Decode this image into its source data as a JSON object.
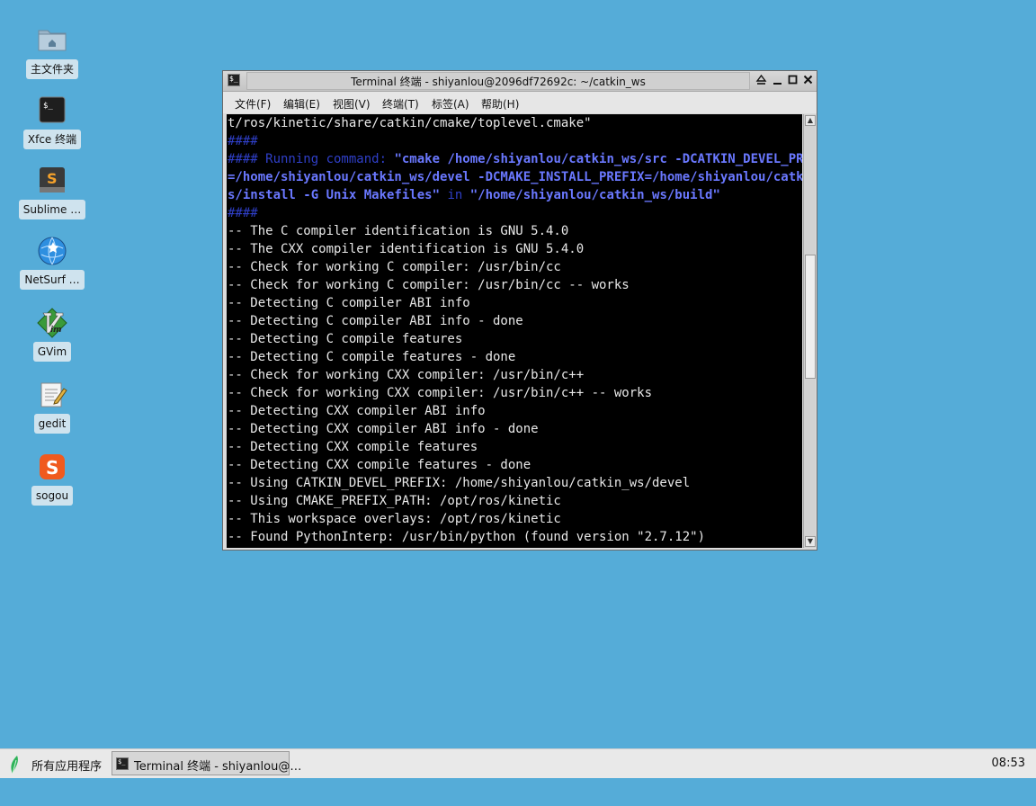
{
  "desktop": {
    "icons": [
      {
        "label": "主文件夹",
        "icon": "home-folder-icon"
      },
      {
        "label": "Xfce 终端",
        "icon": "terminal-icon"
      },
      {
        "label": "Sublime …",
        "icon": "sublime-icon"
      },
      {
        "label": "NetSurf …",
        "icon": "netsurf-globe-icon"
      },
      {
        "label": "GVim",
        "icon": "gvim-icon"
      },
      {
        "label": "gedit",
        "icon": "gedit-icon"
      },
      {
        "label": "sogou",
        "icon": "sogou-icon"
      }
    ]
  },
  "window": {
    "title": "Terminal 终端 - shiyanlou@2096df72692c: ~/catkin_ws",
    "buttons": {
      "shade": "⏶",
      "minimize": "_",
      "maximize": "□",
      "close": "✕"
    },
    "menu": [
      "文件(F)",
      "编辑(E)",
      "视图(V)",
      "终端(T)",
      "标签(A)",
      "帮助(H)"
    ]
  },
  "terminal": {
    "l0": "t/ros/kinetic/share/catkin/cmake/toplevel.cmake\"",
    "l1": "####",
    "l2_a": "#### Running command: ",
    "l2_b": "\"cmake /home/shiyanlou/catkin_ws/src -DCATKIN_DEVEL_PREFIX",
    "l3": "=/home/shiyanlou/catkin_ws/devel -DCMAKE_INSTALL_PREFIX=/home/shiyanlou/catkin_w",
    "l4_a": "s/install -G Unix Makefiles\"",
    "l4_b": " in ",
    "l4_c": "\"/home/shiyanlou/catkin_ws/build\"",
    "l5": "####",
    "output": [
      "-- The C compiler identification is GNU 5.4.0",
      "-- The CXX compiler identification is GNU 5.4.0",
      "-- Check for working C compiler: /usr/bin/cc",
      "-- Check for working C compiler: /usr/bin/cc -- works",
      "-- Detecting C compiler ABI info",
      "-- Detecting C compiler ABI info - done",
      "-- Detecting C compile features",
      "-- Detecting C compile features - done",
      "-- Check for working CXX compiler: /usr/bin/c++",
      "-- Check for working CXX compiler: /usr/bin/c++ -- works",
      "-- Detecting CXX compiler ABI info",
      "-- Detecting CXX compiler ABI info - done",
      "-- Detecting CXX compile features",
      "-- Detecting CXX compile features - done",
      "-- Using CATKIN_DEVEL_PREFIX: /home/shiyanlou/catkin_ws/devel",
      "-- Using CMAKE_PREFIX_PATH: /opt/ros/kinetic",
      "-- This workspace overlays: /opt/ros/kinetic",
      "-- Found PythonInterp: /usr/bin/python (found version \"2.7.12\")"
    ]
  },
  "taskbar": {
    "start_label": "所有应用程序",
    "task_label": "Terminal 终端 - shiyanlou@…",
    "clock": "08:53"
  },
  "colors": {
    "desktop_bg": "#55acd8",
    "terminal_bg": "#000000",
    "command_blue": "#6a78ff",
    "comment_blue": "#2f3fc8"
  }
}
